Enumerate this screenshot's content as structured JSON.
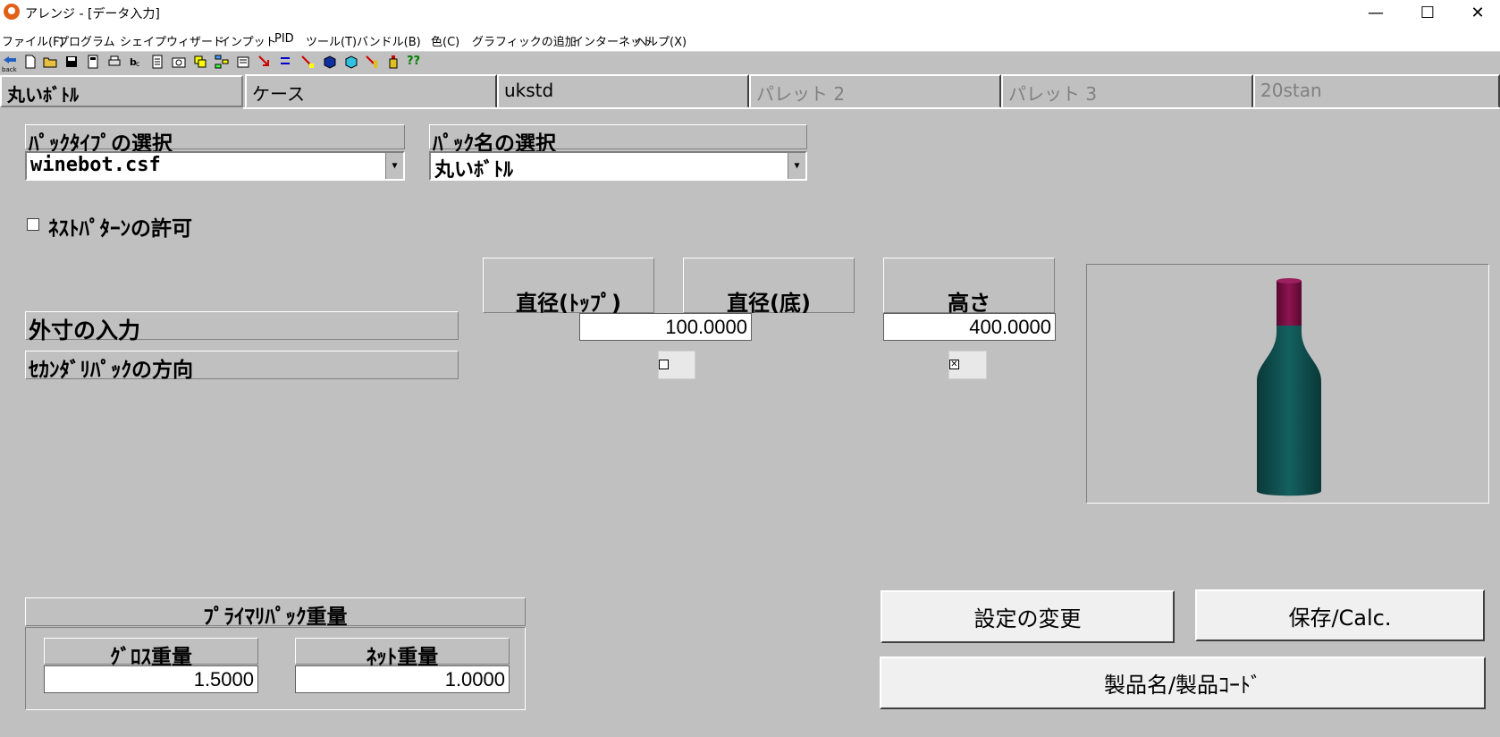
{
  "window": {
    "title": "アレンジ - [データ入力]",
    "minimize": "—",
    "maximize": "☐",
    "close": "✕"
  },
  "menu": [
    "ファイル(F)",
    "プログラム",
    "シェイプウィザード",
    "インプット",
    "PID",
    "ツール(T)",
    "バンドル(B)",
    "色(C)",
    "グラフィックの追加",
    "インターネット",
    "ヘルプ(X)"
  ],
  "toolbar": {
    "back_label": "back",
    "icons": [
      "new-file-icon",
      "open-folder-icon",
      "save-icon",
      "calculator-icon",
      "print-icon",
      "text-icon",
      "document-icon",
      "camera-icon",
      "copy-icon",
      "hierarchy-icon",
      "settings-icon",
      "arrows-icon",
      "arrows2-icon",
      "arrows3-icon",
      "cube-blue-icon",
      "cube-cyan-icon",
      "bottle-tools-icon",
      "bottle-icon",
      "help-icon"
    ],
    "help_label": "??"
  },
  "tabs": [
    {
      "label": "丸いﾎﾞﾄﾙ",
      "active": true
    },
    {
      "label": "ケース",
      "active": false,
      "enabled": true
    },
    {
      "label": "ukstd",
      "active": false,
      "enabled": true
    },
    {
      "label": "パレット 2",
      "active": false,
      "enabled": false
    },
    {
      "label": "パレット 3",
      "active": false,
      "enabled": false
    },
    {
      "label": "20stan",
      "active": false,
      "enabled": false
    }
  ],
  "pack_type": {
    "label": "ﾊﾟｯｸﾀｲﾌﾟの選択",
    "value": "winebot.csf"
  },
  "pack_name": {
    "label": "ﾊﾟｯｸ名の選択",
    "value": "丸いﾎﾞﾄﾙ"
  },
  "nest_pattern": {
    "label": "ﾈｽﾄﾊﾟﾀｰﾝの許可",
    "checked": false
  },
  "dimensions": {
    "row_label": "外寸の入力",
    "orientation_label": "ｾｶﾝﾀﾞﾘﾊﾟｯｸの方向",
    "col_top": "直径(ﾄｯﾌﾟ)",
    "col_bottom": "直径(底)",
    "col_height": "高さ",
    "diameter_value": "100.0000",
    "height_value": "400.0000",
    "diameter_orient_checked": false,
    "height_orient_checked": true,
    "check_mark": "✕"
  },
  "weights": {
    "group_label": "ﾌﾟﾗｲﾏﾘﾊﾟｯｸ重量",
    "gross_label": "ｸﾞﾛｽ重量",
    "gross_value": "1.5000",
    "net_label": "ﾈｯﾄ重量",
    "net_value": "1.0000"
  },
  "buttons": {
    "change_settings": "設定の変更",
    "save_calc": "保存/Calc.",
    "product_name": "製品名/製品ｺｰﾄﾞ"
  },
  "colors": {
    "bottle_body": "#0d4a4a",
    "bottle_cap": "#7a1040",
    "background": "#c0c0c0"
  }
}
